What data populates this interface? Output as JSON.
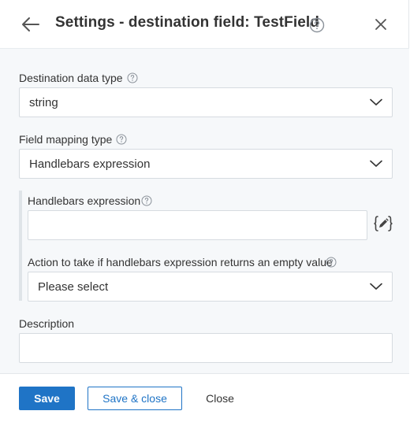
{
  "header": {
    "title": "Settings - destination field: TestField"
  },
  "form": {
    "destination_data_type": {
      "label": "Destination data type",
      "value": "string"
    },
    "field_mapping_type": {
      "label": "Field mapping type",
      "value": "Handlebars expression"
    },
    "handlebars_expression": {
      "label": "Handlebars expression",
      "value": ""
    },
    "empty_action": {
      "label": "Action to take if handlebars expression returns an empty value",
      "value": "Please select"
    },
    "description": {
      "label": "Description",
      "value": ""
    }
  },
  "footer": {
    "save_label": "Save",
    "save_close_label": "Save & close",
    "close_label": "Close"
  },
  "icons": {
    "back": "arrow-left-icon",
    "help": "question-circle-icon",
    "close": "close-icon",
    "chevron": "chevron-down-icon",
    "script": "handlebars-editor-icon"
  },
  "colors": {
    "primary": "#1f74c6",
    "panel_bg": "#f6f8fa",
    "border": "#d6dbe0"
  }
}
